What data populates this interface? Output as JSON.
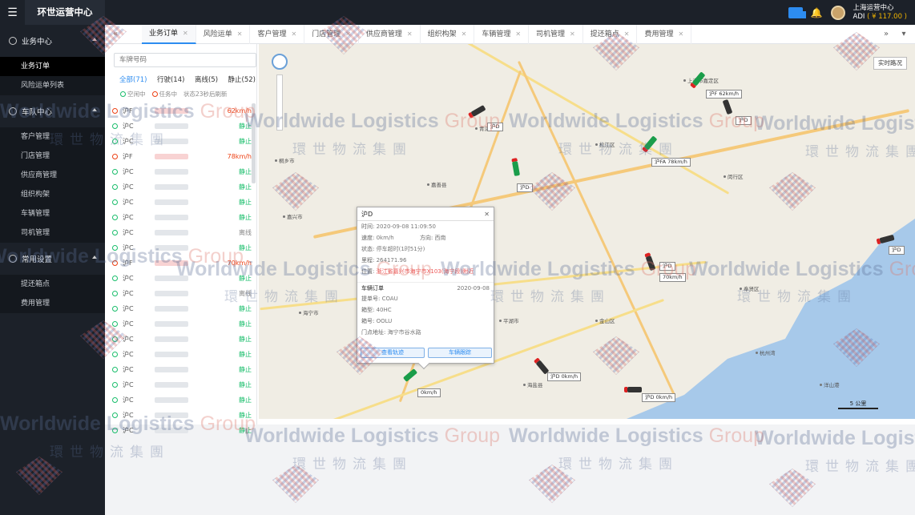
{
  "app": {
    "title": "环世运营中心"
  },
  "user": {
    "name": "上海运营中心",
    "account": "ADI",
    "balance": "( ¥ 117.00 )"
  },
  "sidebar": {
    "groups": [
      {
        "title": "业务中心",
        "items": [
          "业务订单",
          "风险运单列表"
        ]
      },
      {
        "title": "车队中心",
        "items": [
          "客户管理",
          "门店管理",
          "供应商管理",
          "组织构架",
          "车辆管理",
          "司机管理"
        ]
      },
      {
        "title": "常用设置",
        "items": [
          "提还箱点",
          "费用管理"
        ]
      }
    ]
  },
  "tabs": [
    "业务订单",
    "风险运单",
    "客户管理",
    "门店管理",
    "供应商管理",
    "组织构架",
    "车辆管理",
    "司机管理",
    "提还箱点",
    "费用管理"
  ],
  "panel": {
    "search_placeholder": "车牌号码",
    "filters": [
      "全部(71)",
      "行驶(14)",
      "离线(5)",
      "静止(52)"
    ],
    "legend": {
      "idle": "空闲中",
      "busy": "任务中",
      "refresh": "状态23秒后刷新"
    },
    "vehicles": [
      {
        "plate": "沪F",
        "status": "62km/h",
        "tone": "red"
      },
      {
        "plate": "沪C",
        "status": "静止",
        "tone": "green"
      },
      {
        "plate": "沪C",
        "status": "静止",
        "tone": "green"
      },
      {
        "plate": "沪F",
        "status": "78km/h",
        "tone": "red"
      },
      {
        "plate": "沪C",
        "status": "静止",
        "tone": "green"
      },
      {
        "plate": "沪C",
        "status": "静止",
        "tone": "green"
      },
      {
        "plate": "沪C",
        "status": "静止",
        "tone": "green"
      },
      {
        "plate": "沪C",
        "status": "静止",
        "tone": "green"
      },
      {
        "plate": "沪C",
        "status": "离线",
        "tone": "gray"
      },
      {
        "plate": "沪C",
        "status": "静止",
        "tone": "green"
      },
      {
        "plate": "沪F",
        "status": "70km/h",
        "tone": "red"
      },
      {
        "plate": "沪C",
        "status": "静止",
        "tone": "green"
      },
      {
        "plate": "沪C",
        "status": "离线",
        "tone": "gray"
      },
      {
        "plate": "沪C",
        "status": "静止",
        "tone": "green"
      },
      {
        "plate": "沪C",
        "status": "静止",
        "tone": "green"
      },
      {
        "plate": "沪C",
        "status": "静止",
        "tone": "green"
      },
      {
        "plate": "沪C",
        "status": "静止",
        "tone": "green"
      },
      {
        "plate": "沪C",
        "status": "静止",
        "tone": "green"
      },
      {
        "plate": "沪C",
        "status": "静止",
        "tone": "green"
      },
      {
        "plate": "沪C",
        "status": "静止",
        "tone": "green"
      },
      {
        "plate": "沪C",
        "status": "静止",
        "tone": "green"
      },
      {
        "plate": "沪C",
        "status": "静止",
        "tone": "green"
      }
    ]
  },
  "map": {
    "realtime_button": "实时路况",
    "scale": "5 公里",
    "labels": [
      "沪F",
      "62km/h",
      "沪D",
      "沪FA",
      "78km/h",
      "沪D",
      "沪D",
      "沪D",
      "70km/h",
      "沪D",
      "0km/h",
      "沪D",
      "0km/h",
      "沪D",
      "0km/h"
    ],
    "towns": [
      "上海市嘉定区",
      "松江区",
      "青浦区",
      "闵行区",
      "金山区",
      "奉贤区",
      "平湖市",
      "嘉善县",
      "嘉兴市",
      "海盐县",
      "海宁市",
      "桐乡市",
      "杭州湾",
      "洋山港"
    ]
  },
  "popup": {
    "title": "沪D",
    "time_label": "时间:",
    "time": "2020-09-08 11:09:50",
    "speed_label": "速度:",
    "speed": "0km/h",
    "direction_label": "方向:",
    "direction": "西南",
    "state_label": "状态:",
    "state": "停车超时(1时51分)",
    "mileage_label": "里程:",
    "mileage": "264171.96",
    "position_label": "位置:",
    "position": "浙江省嘉兴市海宁市X103(海宁段)附近",
    "order_title": "车辆订单",
    "order_date": "2020-09-08",
    "bill_label": "提单号:",
    "bill": "COAU",
    "box_label": "箱型:",
    "box": "40HC",
    "box_no_label": "箱号:",
    "box_no": "OOLU",
    "addr_label": "门点地址:",
    "addr": "海宁市谷水路",
    "btn_track": "查看轨迹",
    "btn_follow": "车辆跟踪"
  },
  "watermark": {
    "en": "Worldwide Logistics",
    "group": "Group",
    "cn": "環世物流集團"
  }
}
